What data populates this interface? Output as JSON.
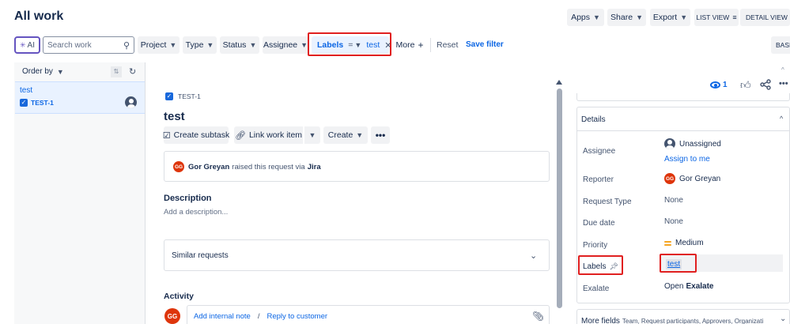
{
  "header": {
    "title": "All work",
    "apps_label": "Apps",
    "share_label": "Share",
    "export_label": "Export",
    "list_view_label": "LIST VIEW",
    "detail_view_label": "DETAIL VIEW"
  },
  "filters": {
    "ai_label": "AI",
    "search_placeholder": "Search work",
    "project": "Project",
    "type": "Type",
    "status": "Status",
    "assignee": "Assignee",
    "labels": "Labels",
    "labels_operator": "=",
    "labels_value": "test",
    "more": "More",
    "reset": "Reset",
    "save_filter": "Save filter",
    "basic": "BASIC"
  },
  "list": {
    "order_by": "Order by",
    "items": [
      {
        "title": "test",
        "key": "TEST-1"
      }
    ]
  },
  "issue": {
    "key": "TEST-1",
    "title": "test",
    "actions": {
      "create_subtask": "Create subtask",
      "link_work_item": "Link work item",
      "create": "Create"
    },
    "request": {
      "avatar": "GG",
      "reporter_name": "Gor Greyan",
      "text": "raised this request via",
      "channel": "Jira"
    },
    "description_heading": "Description",
    "description_placeholder": "Add a description...",
    "similar_requests": "Similar requests",
    "activity_heading": "Activity",
    "comment": {
      "avatar": "GG",
      "internal_note": "Add internal note",
      "separator": "/",
      "reply": "Reply to customer"
    }
  },
  "details": {
    "watch_count": "1",
    "heading": "Details",
    "fields": {
      "assignee_label": "Assignee",
      "assignee_value": "Unassigned",
      "assign_to_me": "Assign to me",
      "reporter_label": "Reporter",
      "reporter_value": "Gor Greyan",
      "reporter_avatar": "GG",
      "request_type_label": "Request Type",
      "request_type_value": "None",
      "due_date_label": "Due date",
      "due_date_value": "None",
      "priority_label": "Priority",
      "priority_value": "Medium",
      "labels_label": "Labels",
      "labels_value": "test",
      "exalate_label": "Exalate",
      "exalate_prefix": "Open",
      "exalate_value": "Exalate"
    },
    "more_fields_label": "More fields",
    "more_fields_list": "Team, Request participants, Approvers, Organizations,..."
  },
  "colors": {
    "accent": "#0c66e4",
    "highlight": "#e02020",
    "avatar": "#de350b",
    "priority_medium": "#f5a623"
  }
}
